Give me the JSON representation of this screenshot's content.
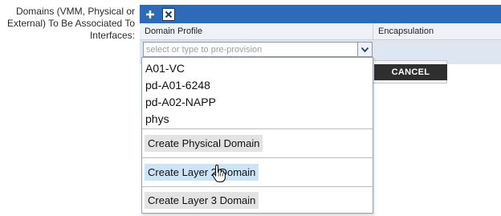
{
  "form": {
    "field_label": "Domains (VMM, Physical or External) To Be Associated To Interfaces:"
  },
  "toolbar": {
    "add_icon": "plus-icon",
    "close_icon": "close-x-icon"
  },
  "table": {
    "columns": [
      "Domain Profile",
      "Encapsulation"
    ]
  },
  "combo": {
    "placeholder": "select or type to pre-provision",
    "arrow_icon": "chevron-down-icon"
  },
  "dropdown": {
    "options": [
      "A01-VC",
      "pd-A01-6248",
      "pd-A02-NAPP",
      "phys"
    ],
    "actions": [
      "Create Physical Domain",
      "Create Layer 2 Domain",
      "Create Layer 3 Domain"
    ],
    "hovered_action": "Create Layer 2 Domain"
  },
  "buttons": {
    "cancel_label": "CANCEL"
  },
  "colors": {
    "toolbar": "#2d6bb8",
    "row": "#dde6f1",
    "cancel": "#2f2f2f"
  }
}
